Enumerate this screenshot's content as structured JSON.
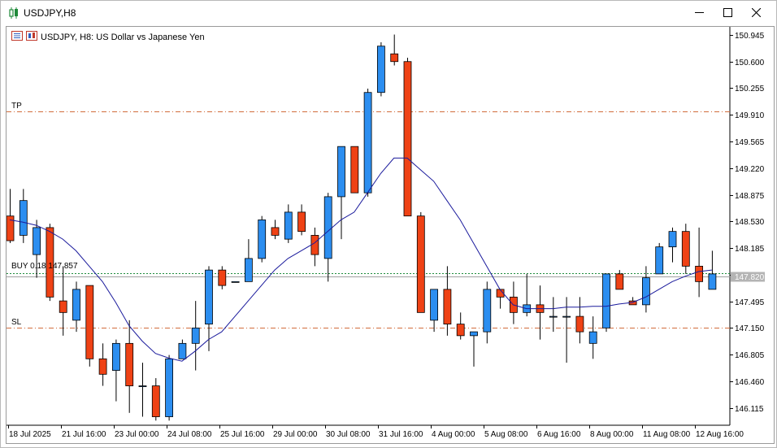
{
  "window": {
    "title": "USDJPY,H8",
    "icon": "candlestick-chart-icon",
    "controls": [
      "minimize-icon",
      "maximize-icon",
      "close-icon"
    ]
  },
  "chart_header": {
    "symbol_text": "USDJPY, H8:  US Dollar vs Japanese Yen",
    "icons": [
      "indicator-list-icon",
      "chart-properties-icon"
    ]
  },
  "levels": {
    "tp_label": "TP",
    "sl_label": "SL",
    "buy_label": "BUY 0.18 147.857",
    "buy_axis_tag": "147.820",
    "tp_price": 149.95,
    "sl_price": 147.15,
    "buy_price": 147.857,
    "bid_price": 147.82
  },
  "colors": {
    "bull": "#2c8ef0",
    "bear": "#ef4215",
    "candle_border": "#000000",
    "ma_line": "#1a1a9c",
    "level_line": "#d26c3c",
    "buy_line": "#1e8c3c",
    "bid_line": "#a0a0a0",
    "axis_tag_bg": "#b4b4b4"
  },
  "chart_data": {
    "type": "candlestick",
    "symbol": "USDJPY",
    "timeframe": "H8",
    "y_range": [
      145.89,
      151.05
    ],
    "y_ticks": [
      "150.945",
      "150.600",
      "150.255",
      "149.910",
      "149.565",
      "149.220",
      "148.875",
      "148.530",
      "148.185",
      "147.840",
      "147.495",
      "147.150",
      "146.805",
      "146.460",
      "146.115"
    ],
    "x_labels": [
      "18 Jul 2025",
      "21 Jul 16:00",
      "23 Jul 00:00",
      "24 Jul 08:00",
      "25 Jul 16:00",
      "29 Jul 00:00",
      "30 Jul 08:00",
      "31 Jul 16:00",
      "4 Aug 00:00",
      "5 Aug 08:00",
      "6 Aug 16:00",
      "8 Aug 00:00",
      "11 Aug 08:00",
      "12 Aug 16:00"
    ],
    "candles": [
      {
        "o": 148.6,
        "h": 148.95,
        "l": 148.25,
        "c": 148.28
      },
      {
        "o": 148.35,
        "h": 148.95,
        "l": 148.25,
        "c": 148.8
      },
      {
        "o": 148.1,
        "h": 148.55,
        "l": 147.8,
        "c": 148.45
      },
      {
        "o": 148.45,
        "h": 148.5,
        "l": 147.5,
        "c": 147.55
      },
      {
        "o": 147.5,
        "h": 147.95,
        "l": 147.05,
        "c": 147.35
      },
      {
        "o": 147.25,
        "h": 147.75,
        "l": 147.1,
        "c": 147.65
      },
      {
        "o": 147.7,
        "h": 147.7,
        "l": 146.65,
        "c": 146.75
      },
      {
        "o": 146.75,
        "h": 146.95,
        "l": 146.4,
        "c": 146.55
      },
      {
        "o": 146.6,
        "h": 147.0,
        "l": 146.2,
        "c": 146.95
      },
      {
        "o": 146.95,
        "h": 147.25,
        "l": 146.05,
        "c": 146.4
      },
      {
        "o": 146.4,
        "h": 146.7,
        "l": 146.0,
        "c": 146.4
      },
      {
        "o": 146.4,
        "h": 146.5,
        "l": 145.95,
        "c": 146.0
      },
      {
        "o": 146.0,
        "h": 146.8,
        "l": 145.95,
        "c": 146.75
      },
      {
        "o": 146.75,
        "h": 147.0,
        "l": 146.75,
        "c": 146.95
      },
      {
        "o": 146.95,
        "h": 147.5,
        "l": 146.6,
        "c": 147.15
      },
      {
        "o": 147.2,
        "h": 147.95,
        "l": 146.85,
        "c": 147.9
      },
      {
        "o": 147.9,
        "h": 147.95,
        "l": 147.65,
        "c": 147.7
      },
      {
        "o": 147.75,
        "h": 147.75,
        "l": 147.75,
        "c": 147.75
      },
      {
        "o": 147.75,
        "h": 148.3,
        "l": 147.75,
        "c": 148.05
      },
      {
        "o": 148.05,
        "h": 148.6,
        "l": 148.0,
        "c": 148.55
      },
      {
        "o": 148.45,
        "h": 148.55,
        "l": 148.3,
        "c": 148.35
      },
      {
        "o": 148.3,
        "h": 148.75,
        "l": 148.25,
        "c": 148.65
      },
      {
        "o": 148.65,
        "h": 148.75,
        "l": 148.35,
        "c": 148.4
      },
      {
        "o": 148.35,
        "h": 148.45,
        "l": 147.95,
        "c": 148.1
      },
      {
        "o": 148.05,
        "h": 148.9,
        "l": 147.75,
        "c": 148.85
      },
      {
        "o": 148.85,
        "h": 149.5,
        "l": 148.3,
        "c": 149.5
      },
      {
        "o": 149.5,
        "h": 149.5,
        "l": 148.9,
        "c": 148.9
      },
      {
        "o": 148.9,
        "h": 150.25,
        "l": 148.85,
        "c": 150.2
      },
      {
        "o": 150.2,
        "h": 150.85,
        "l": 150.15,
        "c": 150.8
      },
      {
        "o": 150.7,
        "h": 150.95,
        "l": 150.55,
        "c": 150.6
      },
      {
        "o": 150.6,
        "h": 150.65,
        "l": 148.6,
        "c": 148.6
      },
      {
        "o": 148.6,
        "h": 148.65,
        "l": 147.35,
        "c": 147.35
      },
      {
        "o": 147.25,
        "h": 147.65,
        "l": 147.1,
        "c": 147.65
      },
      {
        "o": 147.65,
        "h": 147.95,
        "l": 147.05,
        "c": 147.2
      },
      {
        "o": 147.2,
        "h": 147.35,
        "l": 147.0,
        "c": 147.05
      },
      {
        "o": 147.05,
        "h": 147.1,
        "l": 146.65,
        "c": 147.1
      },
      {
        "o": 147.1,
        "h": 147.75,
        "l": 146.95,
        "c": 147.65
      },
      {
        "o": 147.65,
        "h": 147.65,
        "l": 147.4,
        "c": 147.55
      },
      {
        "o": 147.55,
        "h": 147.75,
        "l": 147.2,
        "c": 147.35
      },
      {
        "o": 147.35,
        "h": 147.85,
        "l": 147.3,
        "c": 147.45
      },
      {
        "o": 147.45,
        "h": 147.7,
        "l": 147.0,
        "c": 147.35
      },
      {
        "o": 147.3,
        "h": 147.55,
        "l": 147.1,
        "c": 147.3
      },
      {
        "o": 147.3,
        "h": 147.55,
        "l": 146.7,
        "c": 147.3
      },
      {
        "o": 147.3,
        "h": 147.55,
        "l": 146.95,
        "c": 147.1
      },
      {
        "o": 146.95,
        "h": 147.3,
        "l": 146.75,
        "c": 147.1
      },
      {
        "o": 147.15,
        "h": 147.85,
        "l": 147.1,
        "c": 147.85
      },
      {
        "o": 147.85,
        "h": 147.9,
        "l": 147.65,
        "c": 147.65
      },
      {
        "o": 147.5,
        "h": 147.55,
        "l": 147.45,
        "c": 147.45
      },
      {
        "o": 147.45,
        "h": 147.95,
        "l": 147.35,
        "c": 147.8
      },
      {
        "o": 147.85,
        "h": 148.25,
        "l": 147.85,
        "c": 148.2
      },
      {
        "o": 148.2,
        "h": 148.45,
        "l": 148.0,
        "c": 148.4
      },
      {
        "o": 148.4,
        "h": 148.5,
        "l": 147.85,
        "c": 147.95
      },
      {
        "o": 147.95,
        "h": 148.45,
        "l": 147.55,
        "c": 147.75
      },
      {
        "o": 147.65,
        "h": 148.15,
        "l": 147.65,
        "c": 147.85
      }
    ],
    "ma": [
      148.55,
      148.52,
      148.48,
      148.4,
      148.3,
      148.15,
      147.95,
      147.75,
      147.48,
      147.18,
      146.98,
      146.82,
      146.76,
      146.72,
      146.85,
      147.0,
      147.1,
      147.3,
      147.5,
      147.7,
      147.9,
      148.05,
      148.15,
      148.25,
      148.4,
      148.55,
      148.65,
      148.9,
      149.15,
      149.35,
      149.35,
      149.2,
      149.05,
      148.8,
      148.55,
      148.25,
      147.95,
      147.65,
      147.45,
      147.4,
      147.4,
      147.4,
      147.42,
      147.42,
      147.43,
      147.43,
      147.46,
      147.48,
      147.55,
      147.65,
      147.75,
      147.82,
      147.88,
      147.9
    ]
  }
}
